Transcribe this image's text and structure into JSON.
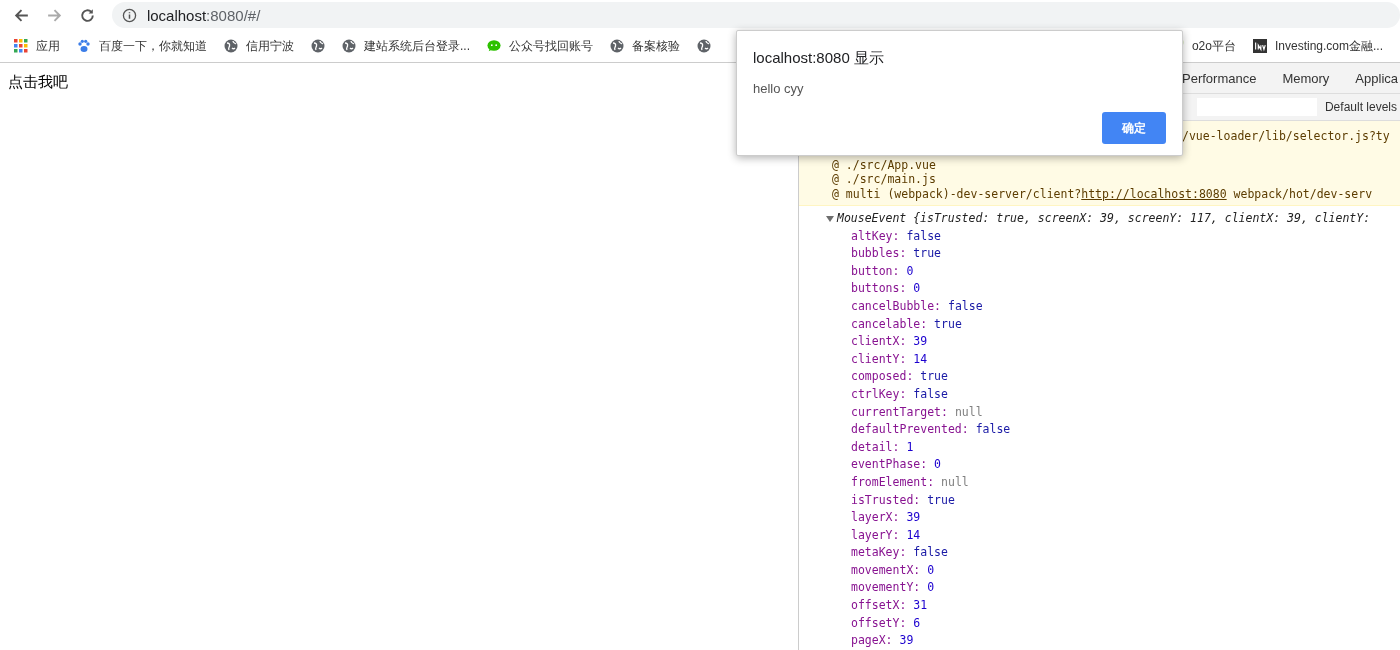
{
  "address_bar": {
    "host": "localhost",
    "rest": ":8080/#/"
  },
  "bookmarks": [
    {
      "kind": "apps",
      "label": "应用"
    },
    {
      "kind": "paw",
      "label": "百度一下，你就知道"
    },
    {
      "kind": "globe",
      "label": "信用宁波"
    },
    {
      "kind": "globe"
    },
    {
      "kind": "globe",
      "label": "建站系统后台登录..."
    },
    {
      "kind": "chat",
      "label": "公众号找回账号"
    },
    {
      "kind": "globe",
      "label": "备案核验"
    },
    {
      "kind": "globe"
    }
  ],
  "bookmarks_right": [
    {
      "kind": "leaf",
      "label": "o2o平台"
    },
    {
      "kind": "inv",
      "label": "Investing.com金融..."
    }
  ],
  "page": {
    "text": "点击我吧"
  },
  "devtools": {
    "tabs": [
      {
        "label": "Performance",
        "selected": false
      },
      {
        "label": "Memory",
        "selected": false
      },
      {
        "label": "Applica",
        "selected": false
      }
    ],
    "levels": "Default levels",
    "warning_lines": [
      "/vue-loader/lib/selector.js?ty",
      "@ ./src/App.vue",
      "@ ./src/main.js"
    ],
    "warning_last": {
      "prefix": "@ multi (webpack)-dev-server/client?",
      "link": "http://localhost:8080",
      "suffix": " webpack/hot/dev-serv"
    },
    "object": {
      "summary": "MouseEvent {isTrusted: true, screenX: 39, screenY: 117, clientX: 39, clientY:",
      "expanded": true,
      "props": [
        {
          "key": "altKey:",
          "value": "false",
          "kind": "keyword"
        },
        {
          "key": "bubbles:",
          "value": "true",
          "kind": "keyword"
        },
        {
          "key": "button:",
          "value": "0",
          "kind": "number"
        },
        {
          "key": "buttons:",
          "value": "0",
          "kind": "number"
        },
        {
          "key": "cancelBubble:",
          "value": "false",
          "kind": "keyword"
        },
        {
          "key": "cancelable:",
          "value": "true",
          "kind": "keyword"
        },
        {
          "key": "clientX:",
          "value": "39",
          "kind": "number"
        },
        {
          "key": "clientY:",
          "value": "14",
          "kind": "number"
        },
        {
          "key": "composed:",
          "value": "true",
          "kind": "keyword"
        },
        {
          "key": "ctrlKey:",
          "value": "false",
          "kind": "keyword"
        },
        {
          "key": "currentTarget:",
          "value": "null",
          "kind": "null"
        },
        {
          "key": "defaultPrevented:",
          "value": "false",
          "kind": "keyword"
        },
        {
          "key": "detail:",
          "value": "1",
          "kind": "number"
        },
        {
          "key": "eventPhase:",
          "value": "0",
          "kind": "number"
        },
        {
          "key": "fromElement:",
          "value": "null",
          "kind": "null"
        },
        {
          "key": "isTrusted:",
          "value": "true",
          "kind": "keyword"
        },
        {
          "key": "layerX:",
          "value": "39",
          "kind": "number"
        },
        {
          "key": "layerY:",
          "value": "14",
          "kind": "number"
        },
        {
          "key": "metaKey:",
          "value": "false",
          "kind": "keyword"
        },
        {
          "key": "movementX:",
          "value": "0",
          "kind": "number"
        },
        {
          "key": "movementY:",
          "value": "0",
          "kind": "number"
        },
        {
          "key": "offsetX:",
          "value": "31",
          "kind": "number"
        },
        {
          "key": "offsetY:",
          "value": "6",
          "kind": "number"
        },
        {
          "key": "pageX:",
          "value": "39",
          "kind": "number"
        }
      ]
    }
  },
  "dialog": {
    "title": "localhost:8080 显示",
    "message": "hello cyy",
    "button": "确定"
  }
}
